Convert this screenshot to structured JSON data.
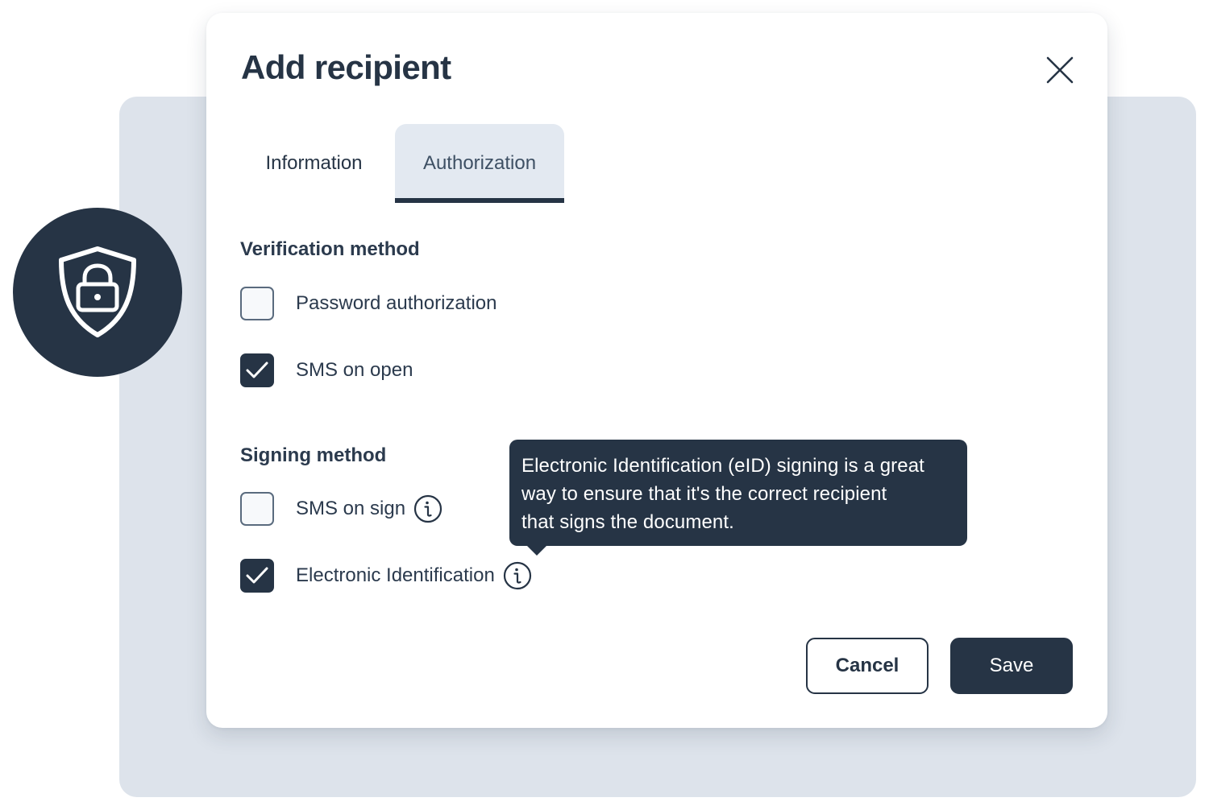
{
  "dialog": {
    "title": "Add recipient",
    "close_icon": "close-icon"
  },
  "tabs": [
    {
      "label": "Information",
      "selected": false
    },
    {
      "label": "Authorization",
      "selected": true
    }
  ],
  "verification": {
    "heading": "Verification method",
    "options": [
      {
        "label": "Password authorization",
        "checked": false
      },
      {
        "label": "SMS on open",
        "checked": true
      }
    ]
  },
  "signing": {
    "heading": "Signing method",
    "options": [
      {
        "label": "SMS on sign",
        "checked": false,
        "icon": "info-icon"
      },
      {
        "label": "Electronic Identification",
        "checked": true,
        "icon": "info-icon"
      }
    ]
  },
  "tooltip": {
    "line1": "Electronic Identification (eID) signing is a great",
    "line2": "way to ensure that it's the correct recipient",
    "line3": "that signs the document."
  },
  "buttons": {
    "cancel": "Cancel",
    "save": "Save"
  },
  "badge": {
    "icon": "shield-lock-icon"
  },
  "colors": {
    "primary_dark": "#263445",
    "backdrop": "#dde3eb",
    "active_tab_bg": "#e3e9f1",
    "surface": "#ffffff"
  }
}
